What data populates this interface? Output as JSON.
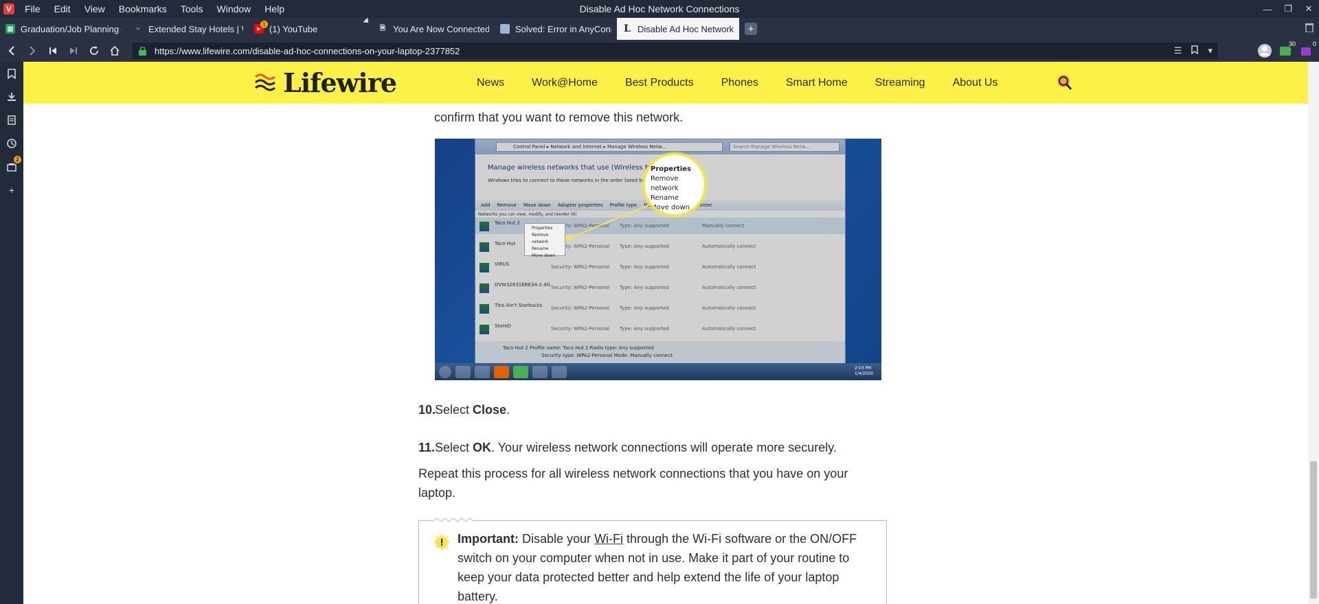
{
  "window": {
    "title": "Disable Ad Hoc Network Connections",
    "menu": [
      "File",
      "Edit",
      "View",
      "Bookmarks",
      "Tools",
      "Window",
      "Help"
    ]
  },
  "tabs": [
    {
      "label": "Graduation/Job Planning - ",
      "icon": "google-sheets-icon",
      "color": "#1e9d58"
    },
    {
      "label": "Extended Stay Hotels | Woo",
      "icon": "leaf-icon",
      "color": "#3aa04a"
    },
    {
      "label": "(1) YouTube",
      "icon": "youtube-icon",
      "color": "#ff0000",
      "badge": "1"
    },
    {
      "label": "You Are Now Connected",
      "icon": "document-icon",
      "color": "#cfd3dc"
    },
    {
      "label": "Solved: Error in AnyConnec",
      "icon": "forum-icon",
      "color": "#9bb6d6"
    },
    {
      "label": "Disable Ad Hoc Network C",
      "icon": "lifewire-icon",
      "color": "#1e2130",
      "active": true
    }
  ],
  "address": {
    "url": "https://www.lifewire.com/disable-ad-hoc-connections-on-your-laptop-2377852"
  },
  "extensions": {
    "badge_a": "30",
    "badge_b": "0"
  },
  "side_panel": {
    "items": [
      "bookmarks-icon",
      "downloads-icon",
      "notes-icon",
      "history-icon",
      "reading-list-icon",
      "add-panel-icon"
    ],
    "badge": "2"
  },
  "site": {
    "logo_text": "Lifewire",
    "nav": [
      "News",
      "Work@Home",
      "Best Products",
      "Phones",
      "Smart Home",
      "Streaming",
      "About Us"
    ],
    "brand_color": "#fdf047"
  },
  "article": {
    "step_intro": "confirm that you want to remove this network.",
    "figure": {
      "address_path": "Control Panel  ▸  Network and Internet  ▸  Manage Wireless Netw...",
      "search_placeholder": "Search Manage Wireless Netw...",
      "heading": "Manage wireless networks that use (Wireless Network",
      "subheading": "Windows tries to connect to these networks in the order listed below.",
      "toolbar": [
        "Add",
        "Remove",
        "Move down",
        "Adapter properties",
        "Profile type",
        "Network and Sharing Center"
      ],
      "list_caption": "Networks you can view, modify, and reorder (6)",
      "rows": [
        {
          "name": "Taco Hut 2",
          "security": "Security: WPA2-Personal",
          "type": "Type: Any supported",
          "connect": "Manually connect"
        },
        {
          "name": "Taco Hut",
          "security": "Security: WPA2-Personal",
          "type": "Type: Any supported",
          "connect": "Automatically connect"
        },
        {
          "name": "VIRUS",
          "security": "Security: WPA2-Personal",
          "type": "Type: Any supported",
          "connect": "Automatically connect"
        },
        {
          "name": "DVW32631EBE34-2.4G",
          "security": "Security: WPA2-Personal",
          "type": "Type: Any supported",
          "connect": "Automatically connect"
        },
        {
          "name": "This Ain't Starbucks",
          "security": "Security: WPA2-Personal",
          "type": "Type: Any supported",
          "connect": "Automatically connect"
        },
        {
          "name": "StoreD",
          "security": "Security: WPA2-Personal",
          "type": "Type: Any supported",
          "connect": "Automatically connect"
        }
      ],
      "context_menu": [
        "Properties",
        "Remove network",
        "Rename",
        "Move down"
      ],
      "zoom_items": [
        "Properties",
        "Remove network",
        "Rename",
        "Move down"
      ],
      "detail_line1": "Taco Hut 2   Profile name:  Taco Hut 2          Radio type:  Any supported",
      "detail_line2": "Security type:  WPA2-Personal        Mode:  Manually connect",
      "clock_time": "2:03 PM",
      "clock_date": "1/4/2020"
    },
    "step10": {
      "num": "10.",
      "pre": "Select ",
      "bold": "Close",
      "post": "."
    },
    "step11": {
      "num": "11.",
      "pre": "Select ",
      "bold": "OK",
      "post": ". Your wireless network connections will operate more securely."
    },
    "repeat": "Repeat this process for all wireless network connections that you have on your laptop.",
    "callout": {
      "label": "Important:",
      "pre": " Disable your ",
      "link": "Wi-Fi",
      "post": " through the Wi-Fi software or the ON/OFF switch on your computer when not in use. Make it part of your routine to keep your data protected better and help extend the life of your laptop battery."
    }
  }
}
